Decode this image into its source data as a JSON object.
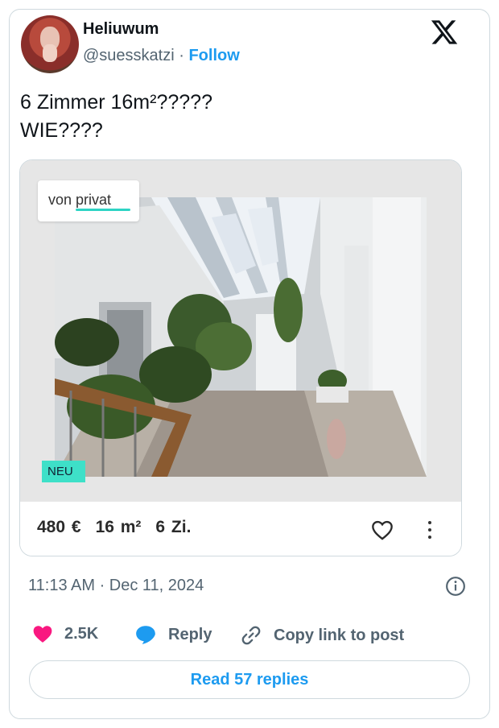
{
  "author": {
    "display_name": "Heliuwum",
    "handle": "@suesskatzi",
    "separator": "·",
    "follow_label": "Follow"
  },
  "tweet": {
    "text_line_1": "6 Zimmer 16m²?????",
    "text_line_2": "WIE????"
  },
  "listing": {
    "tag_prefix": "von ",
    "tag_word": "privat",
    "new_badge": "NEU",
    "price": "480 €",
    "area": "16 m²",
    "rooms": "6 Zi."
  },
  "meta": {
    "timestamp": "11:13 AM · Dec 11, 2024"
  },
  "actions": {
    "likes": "2.5K",
    "reply_label": "Reply",
    "copy_label": "Copy link to post"
  },
  "footer": {
    "read_replies_label": "Read 57 replies"
  },
  "colors": {
    "link_blue": "#1d9bf0",
    "like_pink": "#f91880",
    "secondary_text": "#536471",
    "border": "#cfd9de",
    "badge_teal": "#3ee0c8"
  },
  "icons": [
    "x-logo-icon",
    "heart-outline-icon",
    "kebab-menu-icon",
    "info-icon",
    "heart-filled-icon",
    "speech-bubble-icon",
    "link-icon"
  ]
}
